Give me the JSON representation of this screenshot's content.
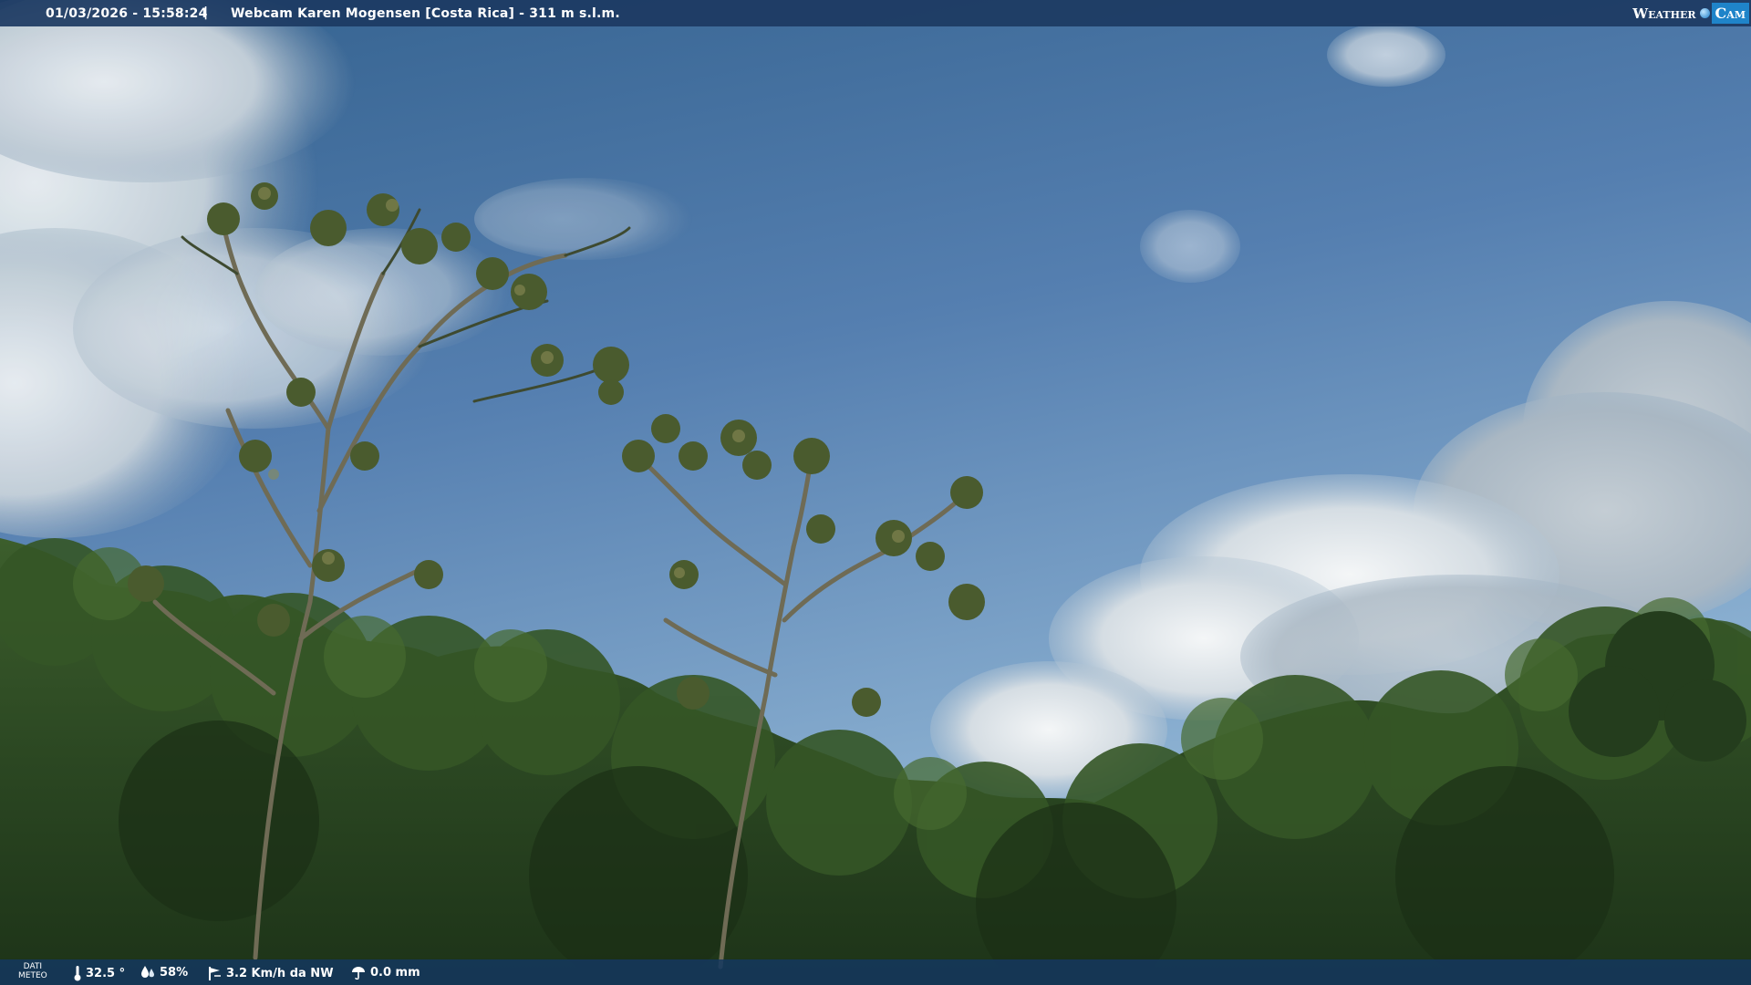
{
  "overlay": {
    "timestamp": "01/03/2026 - 15:58:24",
    "separator": "|",
    "title": "Webcam Karen Mogensen [Costa Rica] - 311 m s.l.m."
  },
  "logo": {
    "weather_text": "Weather",
    "cam_text": "Cam"
  },
  "weather_bar": {
    "label_line1": "DATI",
    "label_line2": "METEO",
    "temperature": "32.5 °",
    "humidity": "58%",
    "wind": "3.2 Km/h da NW",
    "rain": "0.0 mm",
    "icons": [
      "thermometer-icon",
      "humidity-drop-icon",
      "wind-vane-icon",
      "rain-gauge-icon"
    ]
  },
  "colors": {
    "sky_top": "#3d6a9e",
    "sky_bottom": "#8fb4d6",
    "vegetation": "#2d4a24",
    "bar_background": "#1c3a62",
    "logo_accent": "#1f84c9"
  }
}
